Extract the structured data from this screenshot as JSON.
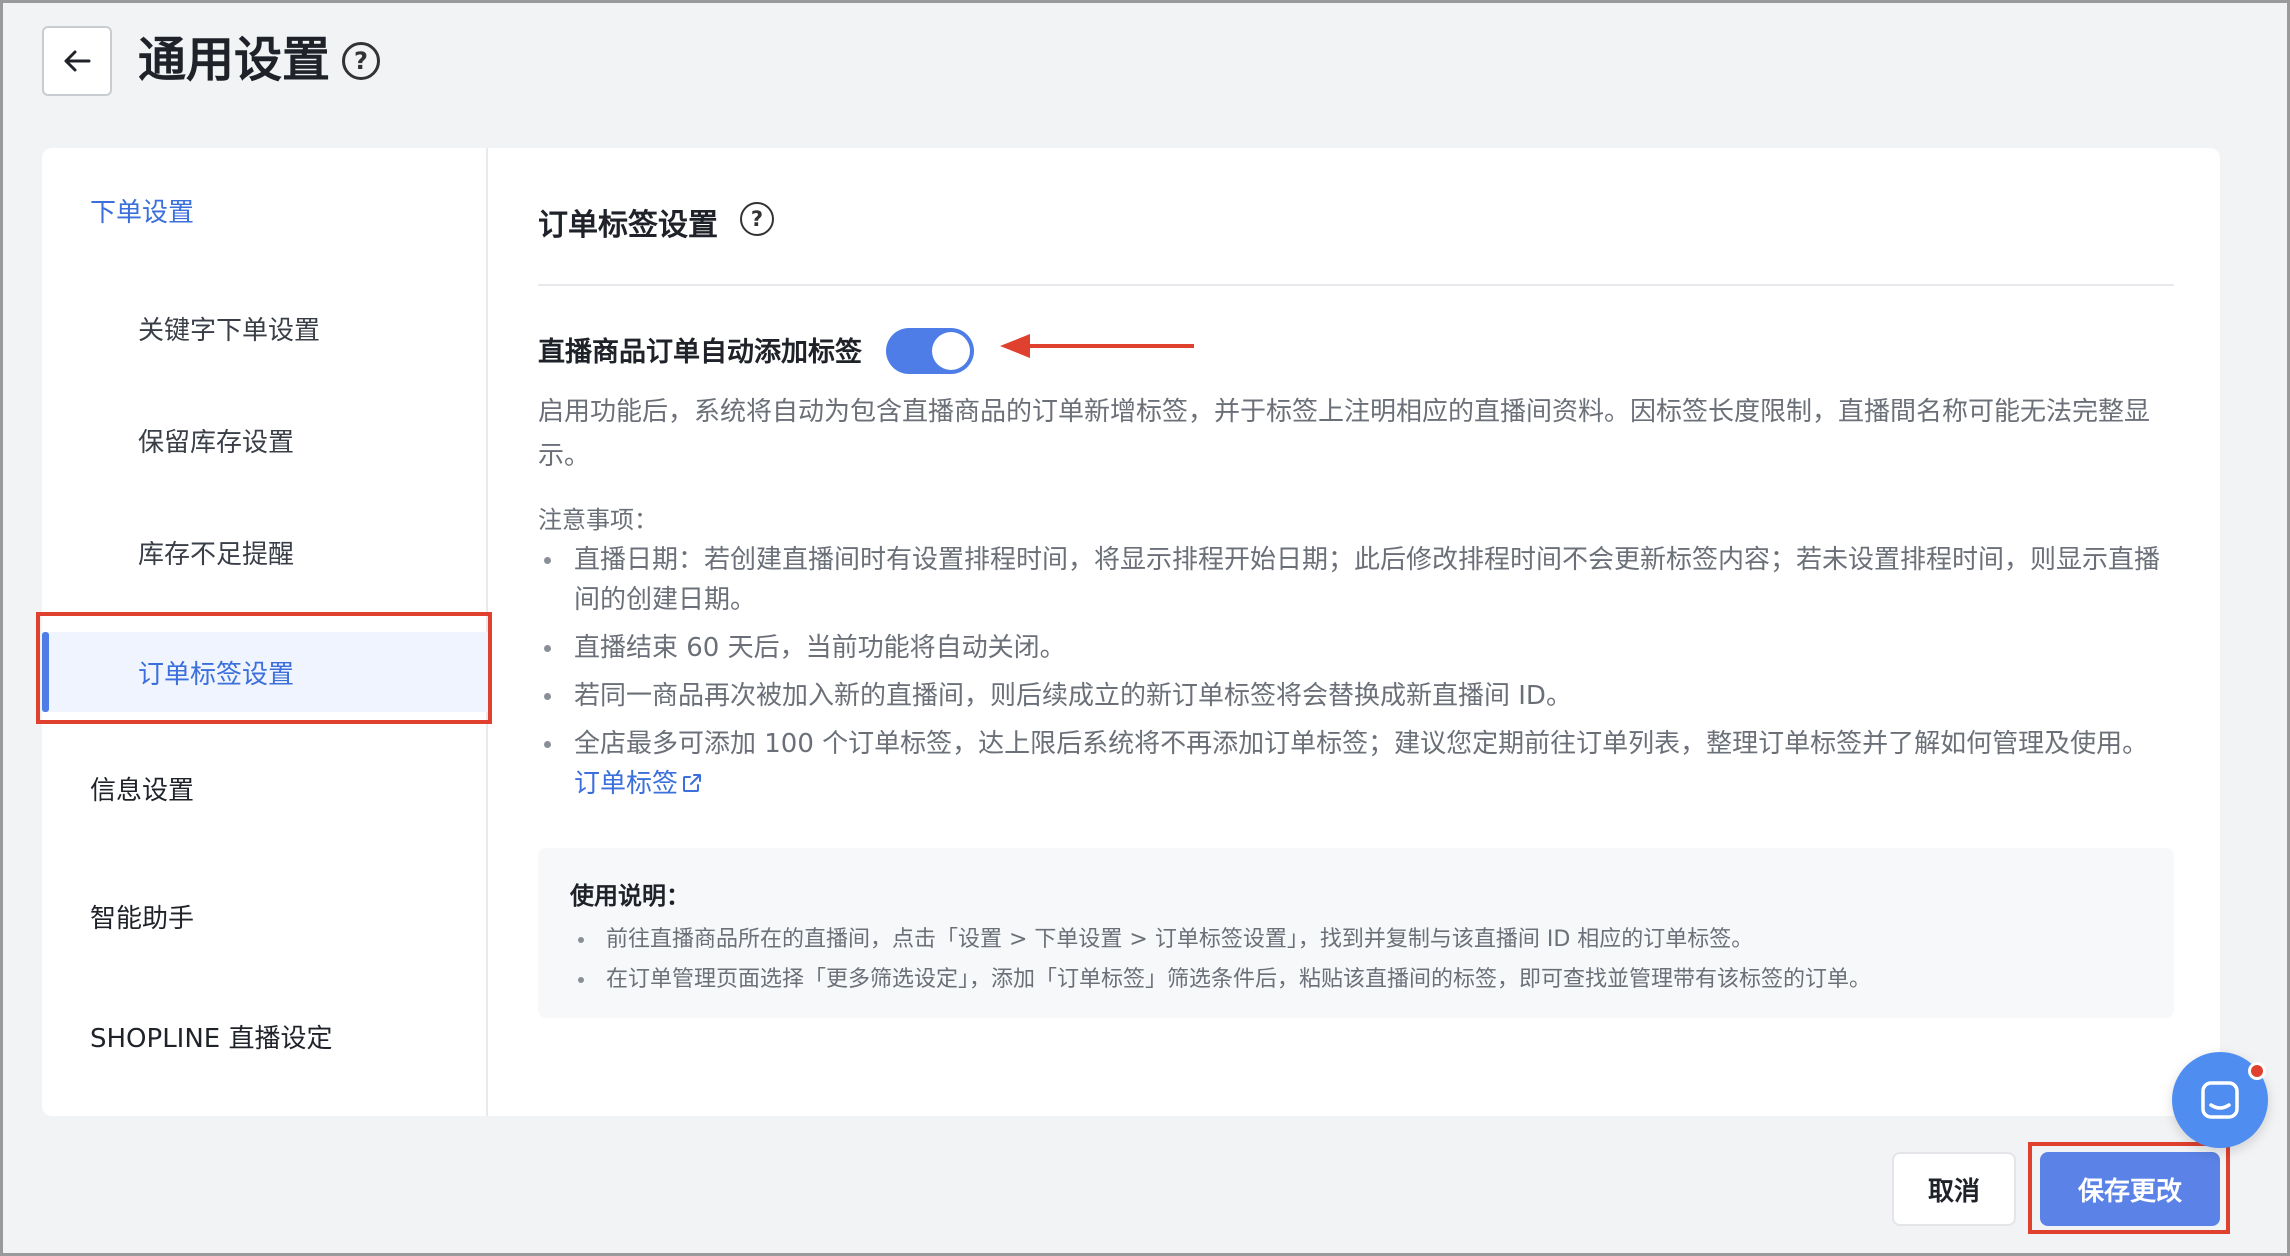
{
  "header": {
    "title": "通用设置",
    "help_icon": "?"
  },
  "sidebar": {
    "items": [
      {
        "label": "下单设置"
      },
      {
        "label": "关键字下单设置"
      },
      {
        "label": "保留库存设置"
      },
      {
        "label": "库存不足提醒"
      },
      {
        "label": "订单标签设置"
      },
      {
        "label": "信息设置"
      },
      {
        "label": "智能助手"
      },
      {
        "label": "SHOPLINE 直播设定"
      }
    ],
    "active_item": "订单标签设置"
  },
  "main": {
    "section_title": "订单标签设置",
    "help_icon": "?",
    "toggle": {
      "label": "直播商品订单自动添加标签",
      "state": "on"
    },
    "description": "启用功能后，系统将自动为包含直播商品的订单新增标签，并于标签上注明相应的直播间资料。因标签长度限制，直播間名称可能无法完整显示。",
    "notes_title": "注意事项：",
    "notes": [
      "直播日期：若创建直播间时有设置排程时间，将显示排程开始日期；此后修改排程时间不会更新标签内容；若未设置排程时间，则显示直播间的创建日期。",
      "直播结束 60 天后，当前功能将自动关闭。",
      "若同一商品再次被加入新的直播间，则后续成立的新订单标签将会替换成新直播间 ID。"
    ],
    "note_last": {
      "text": "全店最多可添加 100 个订单标签，达上限后系统将不再添加订单标签；建议您定期前往订单列表，整理订单标签并了解如何管理及使用。",
      "link_label": "订单标签"
    },
    "usage": {
      "title": "使用说明：",
      "items": [
        "前往直播商品所在的直播间，点击「设置 > 下单设置 > 订单标签设置」，找到并复制与该直播间 ID 相应的订单标签。",
        "在订单管理页面选择「更多筛选设定」，添加「订单标签」筛选条件后，粘贴该直播间的标签，即可查找並管理带有该标签的订单。"
      ]
    }
  },
  "footer": {
    "cancel_label": "取消",
    "save_label": "保存更改"
  },
  "colors": {
    "accent": "#4f7de8",
    "annotation_red": "#e0412f",
    "link": "#3a6fdc"
  },
  "icons": {
    "back": "arrow-left-icon",
    "help": "question-circle-icon",
    "external": "external-link-icon",
    "chat": "chat-bubble-icon"
  }
}
